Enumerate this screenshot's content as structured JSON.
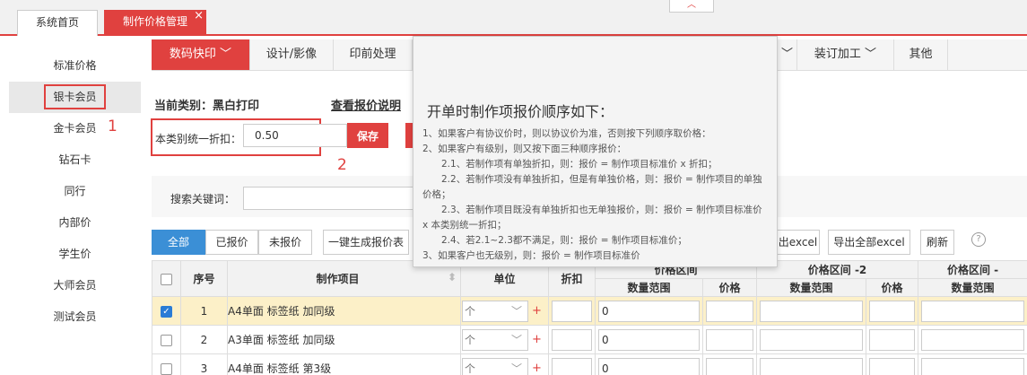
{
  "top_tabs": [
    {
      "label": "系统首页"
    },
    {
      "label": "制作价格管理"
    }
  ],
  "close_glyph": "×",
  "collapse_glyph": "︿",
  "sidebar": {
    "items": [
      "标准价格",
      "银卡会员",
      "金卡会员",
      "钻石卡",
      "同行",
      "内部价",
      "学生价",
      "大师会员",
      "测试会员"
    ]
  },
  "annotations": [
    "1",
    "2"
  ],
  "categories": [
    {
      "label": "数码快印 ﹀"
    },
    {
      "label": "设计/影像"
    },
    {
      "label": "印前处理"
    },
    {
      "label": "﹀"
    },
    {
      "label": "装订加工 ﹀"
    },
    {
      "label": "其他"
    }
  ],
  "current_category": "当前类别：黑白打印",
  "view_price_link": "查看报价说明",
  "discount": {
    "label": "本类别统一折扣：",
    "value": "0.50",
    "save_label": "保存"
  },
  "search": {
    "label": "搜索关键词："
  },
  "filters": {
    "all": "全部",
    "quoted": "已报价",
    "unquoted": "未报价",
    "generate": "一键生成报价表",
    "export_partial": "出excel",
    "export_all": "导出全部excel",
    "refresh": "刷新"
  },
  "table": {
    "headers": {
      "seq": "序号",
      "item": "制作项目",
      "unit": "单位",
      "discount": "折扣",
      "range_1_partial": "价格区间",
      "range_2": "价格区间 -2",
      "range_3": "价格区间 -",
      "qty_range": "数量范围",
      "price": "价格"
    },
    "rows": [
      {
        "seq": "1",
        "item": "A4单面 标签纸 加同级",
        "unit": "个",
        "qty": "0",
        "checked": true
      },
      {
        "seq": "2",
        "item": "A3单面 标签纸 加同级",
        "unit": "个",
        "qty": "0",
        "checked": false
      },
      {
        "seq": "3",
        "item": "A4单面 标签纸 第3级",
        "unit": "个",
        "qty": "0",
        "checked": false
      }
    ]
  },
  "popup": {
    "title": "开单时制作项报价顺序如下：",
    "lines": [
      "1、如果客户有协议价时，则以协议价为准，否则按下列顺序取价格：",
      "2、如果客户有级别，则又按下面三种顺序报价：",
      "　　2.1、若制作项有单独折扣，则：报价 = 制作项目标准价 x 折扣；",
      "　　2.2、若制作项没有单独折扣，但是有单独价格，则：报价 = 制作项目的单独价格；",
      "　　2.3、若制作项目既没有单独折扣也无单独报价，则：报价 = 制作项目标准价 x 本类别统一折扣；",
      "　　2.4、若2.1~2.3都不满足，则：报价 = 制作项目标准价；",
      "3、如果客户也无级别，则：报价 = 制作项目标准价"
    ]
  },
  "icons": {
    "help": "?",
    "checkmark": "✓",
    "plus": "+",
    "chevron": "﹀",
    "sort": "⬍"
  }
}
